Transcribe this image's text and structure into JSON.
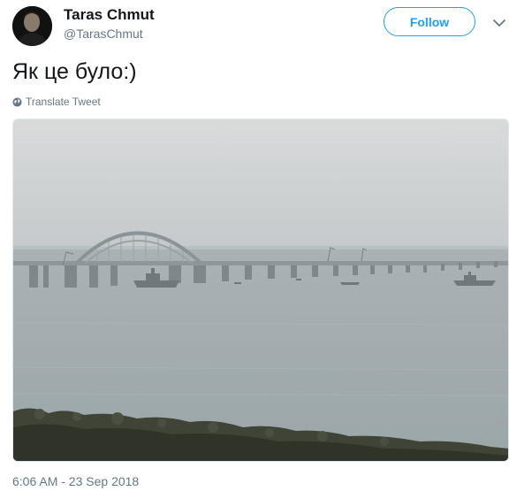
{
  "author": {
    "name": "Taras Chmut",
    "handle": "@TarasChmut"
  },
  "header": {
    "follow_label": "Follow",
    "menu_icon": "chevron-down-icon"
  },
  "tweet": {
    "text": "Як це було:)",
    "translate_label": "Translate Tweet",
    "translate_icon": "globe-icon",
    "timestamp": "6:06 AM - 23 Sep 2018"
  },
  "colors": {
    "accent": "#1da1f2",
    "secondary_text": "#657786",
    "primary_text": "#14171a"
  }
}
